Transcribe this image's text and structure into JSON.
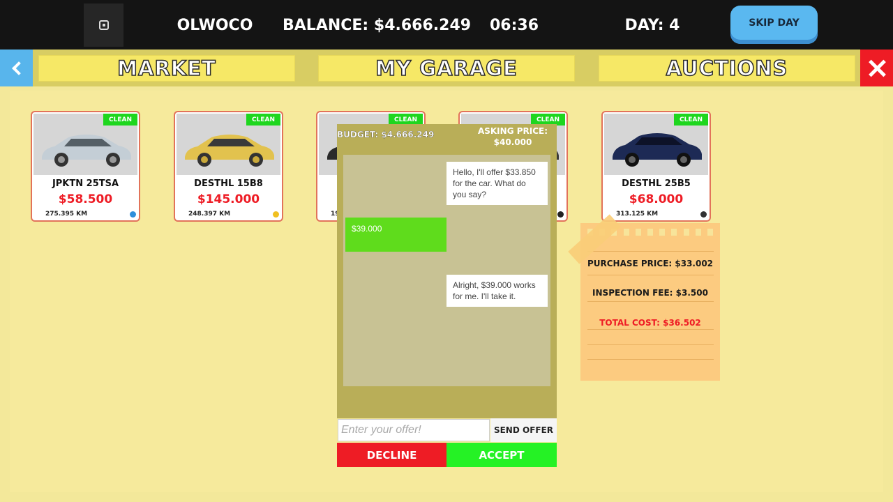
{
  "header": {
    "player": "OLWOCO",
    "balance": "BALANCE: $4.666.249",
    "time": "06:36",
    "day": "DAY: 4",
    "skip_label": "SKIP DAY"
  },
  "tabs": [
    {
      "label": "MARKET"
    },
    {
      "label": "MY GARAGE"
    },
    {
      "label": "AUCTIONS"
    }
  ],
  "cars": [
    {
      "name": "JPKTN 25TSA",
      "price": "$58.500",
      "km": "275.395 KM",
      "badge": "CLEAN",
      "color": "#c4ced6",
      "dot": "#2d8fdb"
    },
    {
      "name": "DESTHL 15B8",
      "price": "$145.000",
      "km": "248.397 KM",
      "badge": "CLEAN",
      "color": "#e2c24e",
      "dot": "#f0c020"
    },
    {
      "name": "",
      "price": "",
      "km": "19",
      "badge": "CLEAN",
      "color": "#2a2a2a",
      "dot": ""
    },
    {
      "name": "",
      "price": "",
      "km": "",
      "badge": "CLEAN",
      "color": "#3a3a3a",
      "dot": "#222222"
    },
    {
      "name": "DESTHL 25B5",
      "price": "$68.000",
      "km": "313.125 KM",
      "badge": "CLEAN",
      "color": "#1d2a55",
      "dot": "#333333"
    }
  ],
  "negotiation": {
    "budget": "BUDGET: $4.666.249",
    "asking_label": "ASKING PRICE:",
    "asking_value": "$40.000",
    "messages": [
      {
        "from": "seller",
        "text": "Hello, I'll offer $33.850 for the car. What do you say?"
      },
      {
        "from": "player",
        "text": "$39.000"
      },
      {
        "from": "seller",
        "text": "Alright, $39.000 works for me. I'll take it."
      }
    ],
    "input_placeholder": "Enter your offer!",
    "send_label": "SEND OFFER",
    "decline_label": "DECLINE",
    "accept_label": "ACCEPT"
  },
  "receipt": {
    "purchase_price": "PURCHASE PRICE: $33.002",
    "inspection_fee": "INSPECTION FEE: $3.500",
    "total_cost": "TOTAL COST: $36.502"
  }
}
